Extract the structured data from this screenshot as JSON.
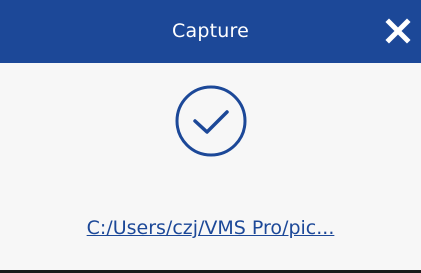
{
  "dialog": {
    "title": "Capture",
    "close_icon": "close-icon",
    "status_icon": "check-circle-icon",
    "saved_path": "C:/Users/czj/VMS Pro/pic...",
    "colors": {
      "titlebar": "#1c4898",
      "accent": "#1c4898",
      "background": "#f7f7f7"
    }
  }
}
